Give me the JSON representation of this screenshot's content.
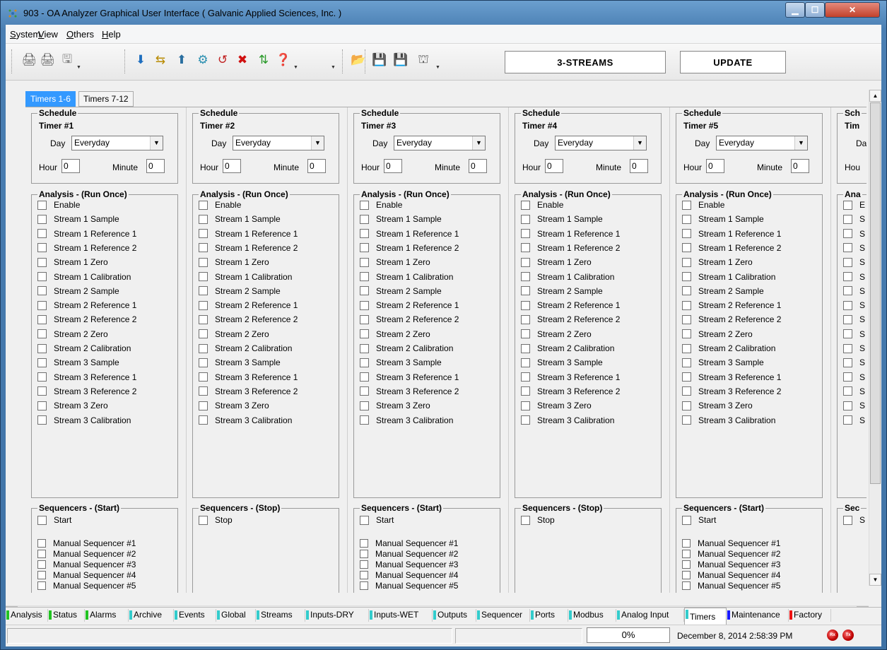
{
  "window": {
    "title": "903 - OA Analyzer Graphical User Interface  ( Galvanic Applied Sciences, Inc. )"
  },
  "menu": [
    {
      "label": "System",
      "underline": "S",
      "rest": "ystem"
    },
    {
      "label": "View",
      "underline": "V",
      "rest": "iew"
    },
    {
      "label": "Others",
      "underline": "O",
      "rest": "thers"
    },
    {
      "label": "Help",
      "underline": "H",
      "rest": "elp"
    }
  ],
  "toolbar": {
    "icons": [
      "printer-icon",
      "printer-setup-icon",
      "device-icon",
      "download-icon",
      "transfer-icon",
      "upload-icon",
      "valve-icon",
      "reset-icon",
      "stop-icon",
      "signal-icon",
      "help-icon",
      "open-folder-icon",
      "save-icon",
      "save-as-icon",
      "flow-icon"
    ],
    "streams_panel": "3-STREAMS",
    "update_panel": "UPDATE"
  },
  "subtabs": [
    "Timers 1-6",
    "Timers 7-12"
  ],
  "schedule_title": "Schedule",
  "analysis_title": "Analysis - (Run Once)",
  "labels": {
    "day": "Day",
    "hour": "Hour",
    "minute": "Minute"
  },
  "analysis_items": [
    "Enable",
    "Stream 1 Sample",
    "Stream 1 Reference 1",
    "Stream 1 Reference 2",
    "Stream 1 Zero",
    "Stream 1 Calibration",
    "Stream 2 Sample",
    "Stream 2 Reference 1",
    "Stream 2 Reference 2",
    "Stream 2 Zero",
    "Stream 2 Calibration",
    "Stream 3 Sample",
    "Stream 3 Reference 1",
    "Stream 3 Reference 2",
    "Stream 3 Zero",
    "Stream 3 Calibration"
  ],
  "timers": [
    {
      "label": "Timer #1",
      "day": "Everyday",
      "hour": "0",
      "minute": "0",
      "seq_title": "Sequencers - (Start)",
      "seq_mode": "start"
    },
    {
      "label": "Timer #2",
      "day": "Everyday",
      "hour": "0",
      "minute": "0",
      "seq_title": "Sequencers - (Stop)",
      "seq_mode": "stop"
    },
    {
      "label": "Timer #3",
      "day": "Everyday",
      "hour": "0",
      "minute": "0",
      "seq_title": "Sequencers - (Start)",
      "seq_mode": "start"
    },
    {
      "label": "Timer #4",
      "day": "Everyday",
      "hour": "0",
      "minute": "0",
      "seq_title": "Sequencers - (Stop)",
      "seq_mode": "stop"
    },
    {
      "label": "Timer #5",
      "day": "Everyday",
      "hour": "0",
      "minute": "0",
      "seq_title": "Sequencers - (Start)",
      "seq_mode": "start"
    },
    {
      "label": "Tim",
      "day": "",
      "hour": "",
      "minute": "",
      "seq_title": "Sec",
      "seq_mode": "partial"
    }
  ],
  "partial_col": {
    "schedule": "Sch",
    "day": "Da",
    "hour": "Hou",
    "analysis": "Ana",
    "items": [
      "E",
      "S",
      "S",
      "S",
      "S",
      "S",
      "S",
      "S",
      "S",
      "S",
      "S",
      "S",
      "S",
      "S",
      "S",
      "S"
    ],
    "seq": "S"
  },
  "seq_start_items": {
    "start": "Start",
    "manual": [
      "Manual Sequencer #1",
      "Manual Sequencer #2",
      "Manual Sequencer #3",
      "Manual Sequencer #4",
      "Manual Sequencer #5"
    ]
  },
  "seq_stop_items": {
    "stop": "Stop"
  },
  "bottom_tabs": [
    {
      "label": "Analysis",
      "color": "#22c322"
    },
    {
      "label": "Status",
      "color": "#22c322"
    },
    {
      "label": "Alarms",
      "color": "#22c322"
    },
    {
      "label": "Archive",
      "color": "#33cccc"
    },
    {
      "label": "Events",
      "color": "#33cccc"
    },
    {
      "label": "Global",
      "color": "#33cccc"
    },
    {
      "label": "Streams",
      "color": "#33cccc"
    },
    {
      "label": "Inputs-DRY",
      "color": "#33cccc"
    },
    {
      "label": "Inputs-WET",
      "color": "#33cccc"
    },
    {
      "label": "Outputs",
      "color": "#33cccc"
    },
    {
      "label": "Sequencer",
      "color": "#33cccc"
    },
    {
      "label": "Ports",
      "color": "#33cccc"
    },
    {
      "label": "Modbus",
      "color": "#33cccc"
    },
    {
      "label": "Analog Input",
      "color": "#33cccc"
    },
    {
      "label": "Timers",
      "color": "#33cccc",
      "active": true
    },
    {
      "label": "Maintenance",
      "color": "#1a1aff"
    },
    {
      "label": "Factory",
      "color": "#ee1111"
    }
  ],
  "status": {
    "progress": "0%",
    "datetime": "December 8, 2014 2:58:39 PM",
    "led1": "Rx",
    "led2": "Tx"
  }
}
